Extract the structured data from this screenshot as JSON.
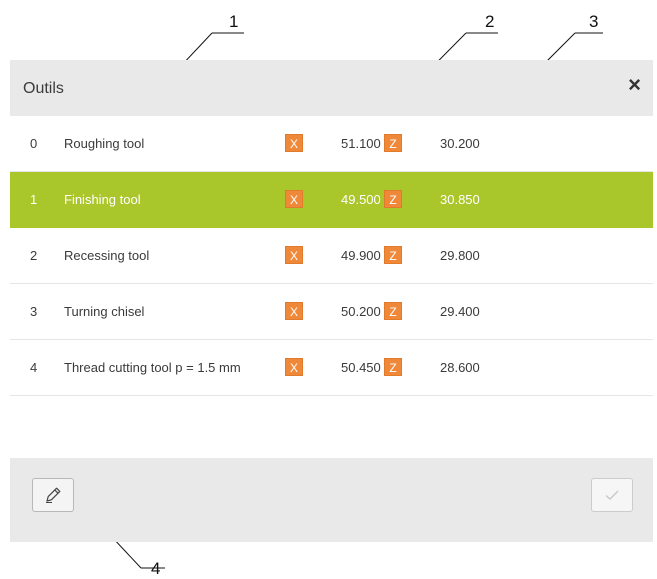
{
  "callouts": [
    "1",
    "2",
    "3",
    "4"
  ],
  "dialog": {
    "title": "Outils",
    "close_symbol": "×"
  },
  "tools": [
    {
      "index": "0",
      "name": "Roughing tool",
      "x_label": "X",
      "x_value": "51.100",
      "z_label": "Z",
      "z_value": "30.200",
      "selected": false
    },
    {
      "index": "1",
      "name": "Finishing tool",
      "x_label": "X",
      "x_value": "49.500",
      "z_label": "Z",
      "z_value": "30.850",
      "selected": true
    },
    {
      "index": "2",
      "name": "Recessing tool",
      "x_label": "X",
      "x_value": "49.900",
      "z_label": "Z",
      "z_value": "29.800",
      "selected": false
    },
    {
      "index": "3",
      "name": "Turning chisel",
      "x_label": "X",
      "x_value": "50.200",
      "z_label": "Z",
      "z_value": "29.400",
      "selected": false
    },
    {
      "index": "4",
      "name": "Thread cutting tool p = 1.5 mm",
      "x_label": "X",
      "x_value": "50.450",
      "z_label": "Z",
      "z_value": "28.600",
      "selected": false
    }
  ],
  "footer": {
    "edit_icon": "pencil-icon",
    "confirm_icon": "checkmark-icon"
  },
  "colors": {
    "selected_row": "#a9c62a",
    "axis_badge": "#f0883a",
    "header_bg": "#e9e9e9"
  }
}
